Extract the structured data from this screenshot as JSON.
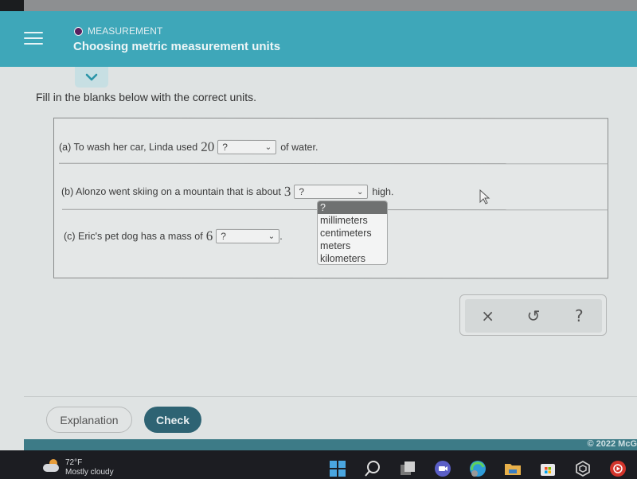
{
  "header": {
    "category": "MEASUREMENT",
    "title": "Choosing metric measurement units"
  },
  "instruction": "Fill in the blanks below with the correct units.",
  "questions": [
    {
      "label": "(a) To wash her car, Linda used",
      "number": "20",
      "selected": "?",
      "after": "of water."
    },
    {
      "label": "(b) Alonzo went skiing on a mountain that is about",
      "number": "3",
      "selected": "?",
      "after": "high."
    },
    {
      "label": "(c) Eric's pet dog has a mass of",
      "number": "6",
      "selected": "?",
      "after": "."
    }
  ],
  "dropdown_open": {
    "for_question": "b",
    "options": [
      "?",
      "millimeters",
      "centimeters",
      "meters",
      "kilometers"
    ],
    "highlighted": "?"
  },
  "tools": {
    "clear_icon": "×",
    "undo_icon": "↺",
    "help_icon": "?"
  },
  "footer": {
    "explanation_label": "Explanation",
    "check_label": "Check",
    "copyright": "© 2022 McG"
  },
  "taskbar": {
    "temperature": "72°F",
    "condition": "Mostly cloudy",
    "colors": {
      "windows": "#4aa6e0",
      "edge": "#2e9bd8",
      "folder": "#e8b04a",
      "youtube_music": "#d3352c"
    }
  }
}
